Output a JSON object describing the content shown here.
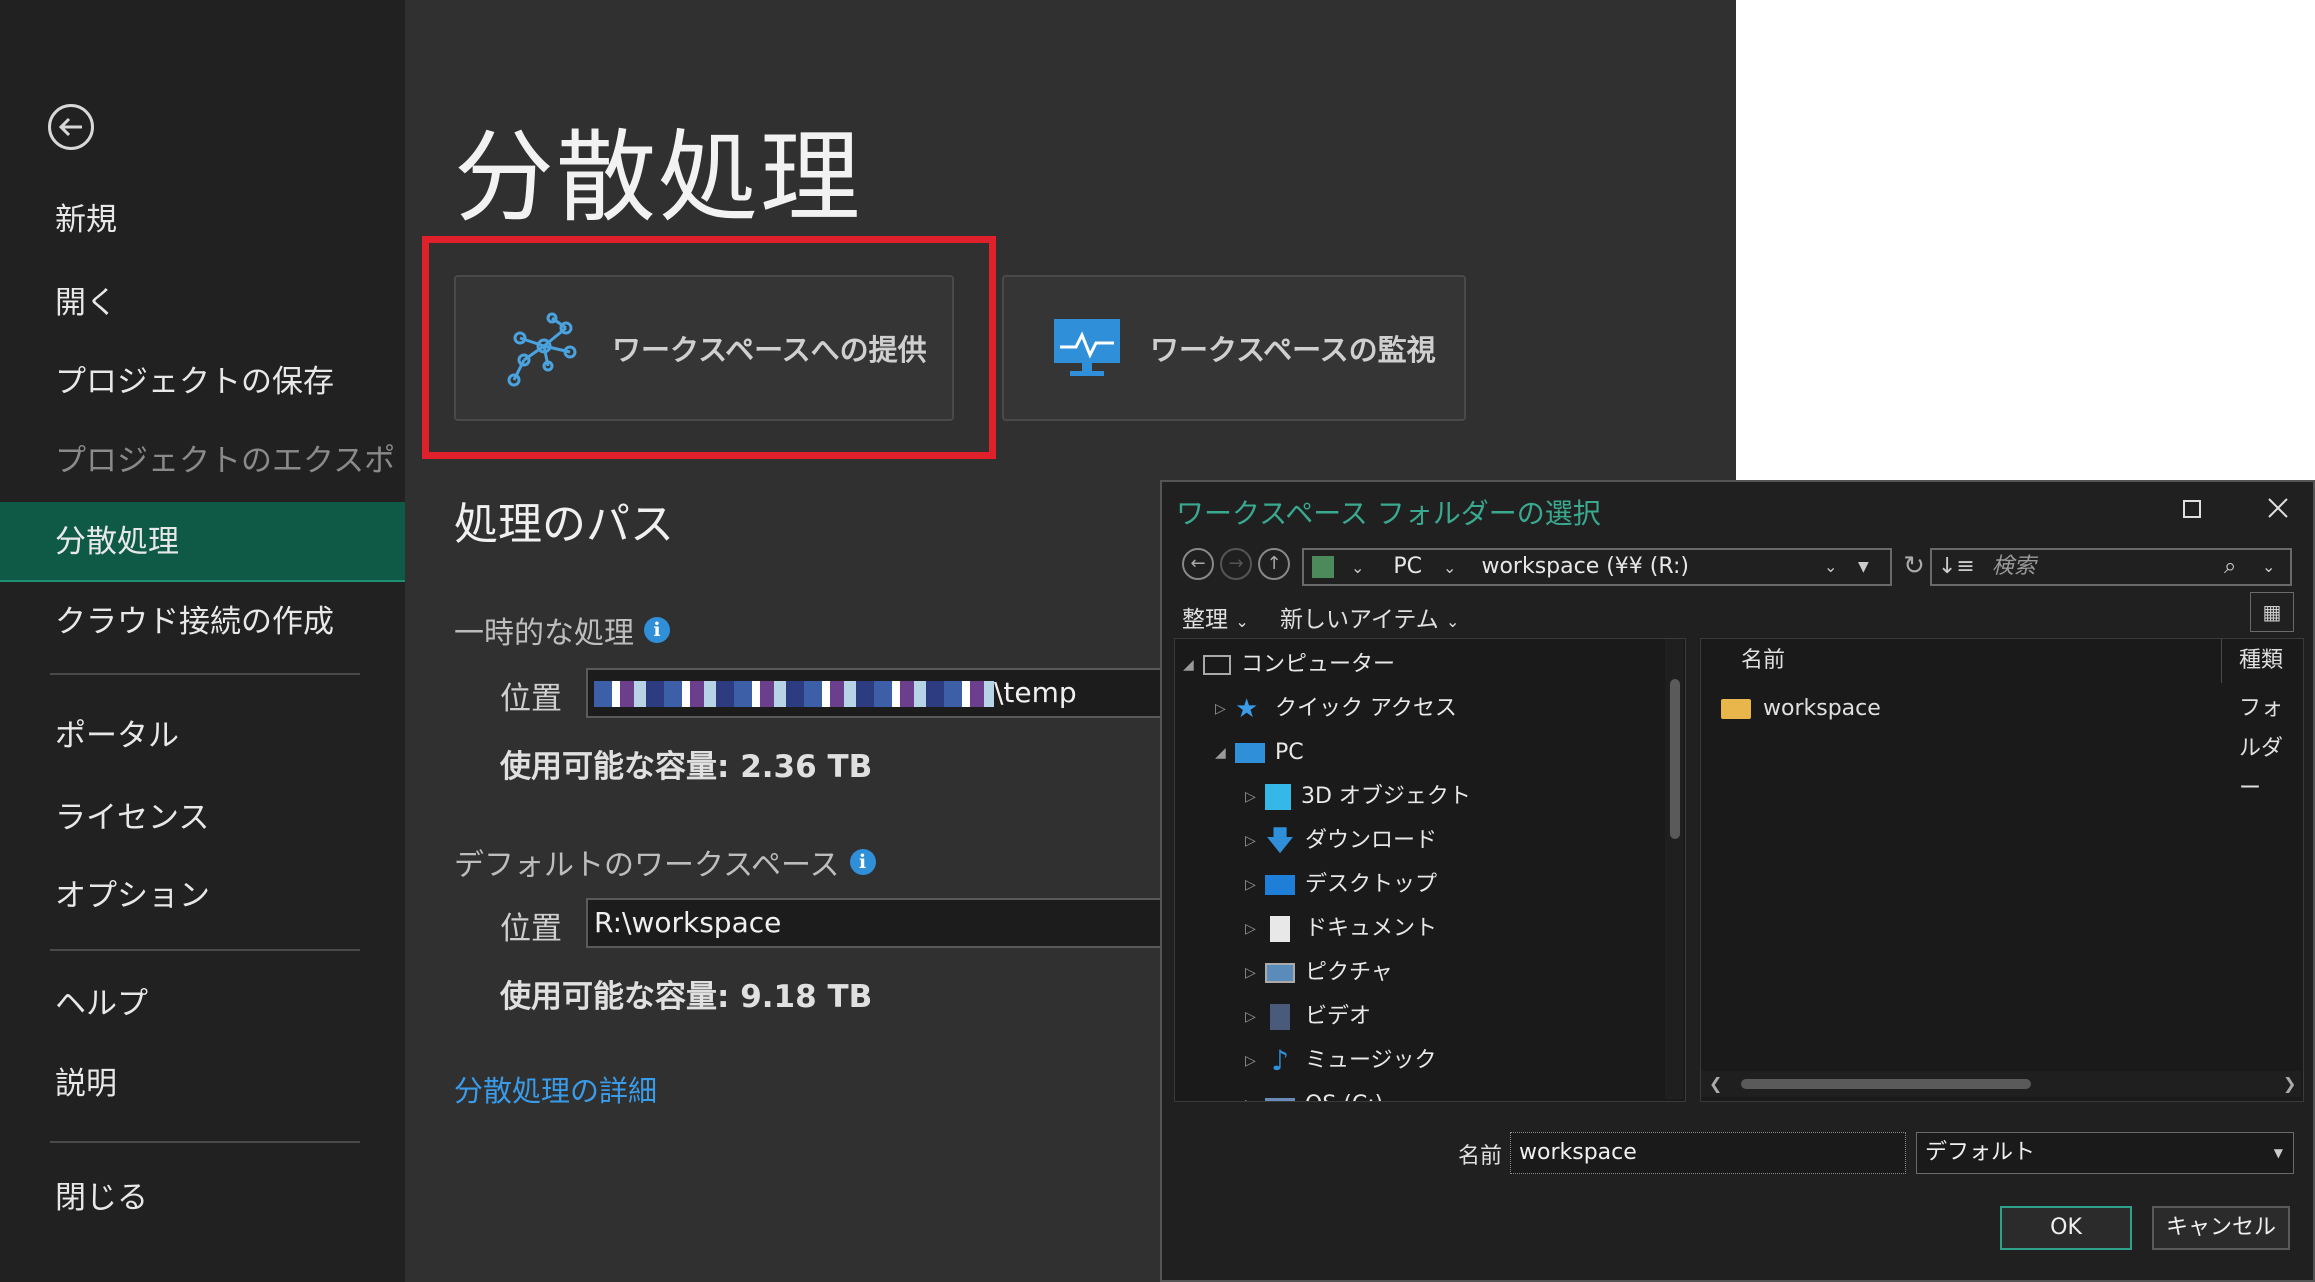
{
  "sidebar": {
    "items": [
      {
        "label": "新規"
      },
      {
        "label": "開く"
      },
      {
        "label": "プロジェクトの保存"
      },
      {
        "label": "プロジェクトのエクスポート"
      },
      {
        "label": "分散処理"
      },
      {
        "label": "クラウド接続の作成"
      },
      {
        "label": "ポータル"
      },
      {
        "label": "ライセンス"
      },
      {
        "label": "オプション"
      },
      {
        "label": "ヘルプ"
      },
      {
        "label": "説明"
      },
      {
        "label": "閉じる"
      }
    ]
  },
  "main": {
    "title": "分散処理",
    "tiles": [
      {
        "label": "ワークスペースへの提供",
        "icon": "network-nodes-icon"
      },
      {
        "label": "ワークスペースの監視",
        "icon": "monitor-chart-icon"
      }
    ],
    "section_title": "処理のパス",
    "temp": {
      "label": "一時的な処理",
      "location_label": "位置",
      "path_suffix": "\\temp",
      "capacity": "使用可能な容量: 2.36 TB"
    },
    "workspace": {
      "label": "デフォルトのワークスペース",
      "location_label": "位置",
      "path": "R:\\workspace",
      "capacity": "使用可能な容量: 9.18 TB"
    },
    "details_link": "分散処理の詳細"
  },
  "dialog": {
    "title": "ワークスペース フォルダーの選択",
    "address": {
      "pc": "PC",
      "drive": "workspace (¥¥ (R:)"
    },
    "search_placeholder": "検索",
    "toolbar": {
      "organize": "整理",
      "new_item": "新しいアイテム"
    },
    "tree": [
      {
        "label": "コンピューター"
      },
      {
        "label": "クイック アクセス"
      },
      {
        "label": "PC"
      },
      {
        "label": "3D オブジェクト"
      },
      {
        "label": "ダウンロード"
      },
      {
        "label": "デスクトップ"
      },
      {
        "label": "ドキュメント"
      },
      {
        "label": "ピクチャ"
      },
      {
        "label": "ビデオ"
      },
      {
        "label": "ミュージック"
      },
      {
        "label": "OS (C:)"
      }
    ],
    "columns": {
      "name": "名前",
      "type": "種類"
    },
    "files": [
      {
        "name": "workspace",
        "type": "フォルダー"
      }
    ],
    "name_label": "名前",
    "name_value": "workspace",
    "type_value": "デフォルト",
    "ok": "OK",
    "cancel": "キャンセル"
  }
}
